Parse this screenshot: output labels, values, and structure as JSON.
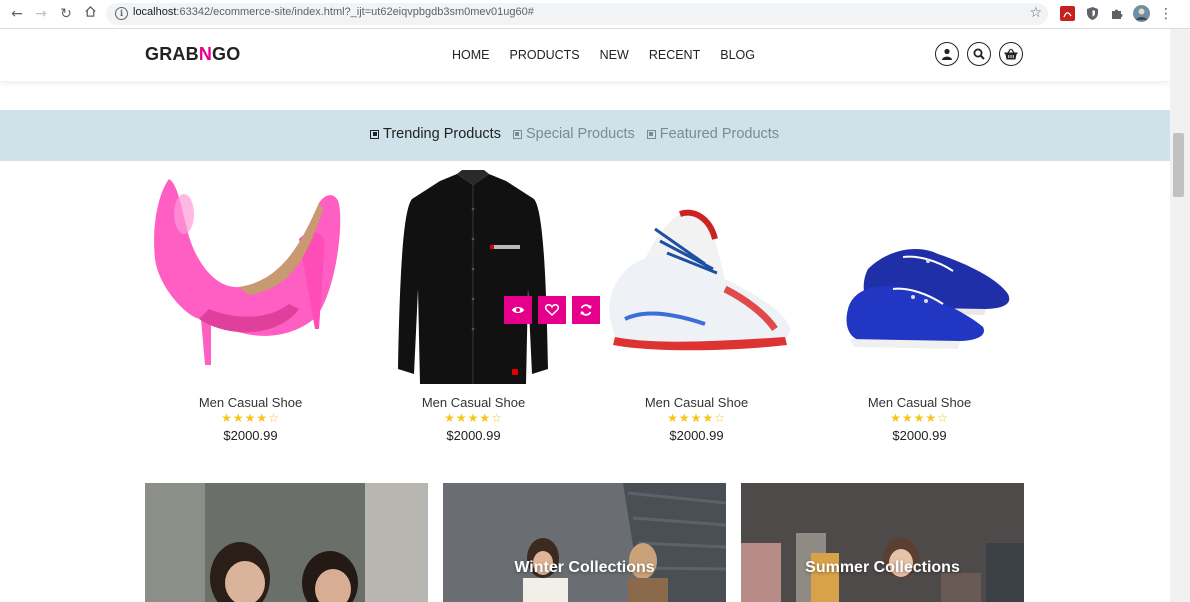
{
  "browser": {
    "url_host": "localhost",
    "url_path": ":63342/ecommerce-site/index.html?_ijt=ut62eiqvpbgdb3sm0mev01ug60#"
  },
  "site": {
    "logo_prefix": "GRAB",
    "logo_accent": "N",
    "logo_suffix": "GO",
    "accent_color": "#e5008b"
  },
  "nav": {
    "items": [
      {
        "label": "HOME"
      },
      {
        "label": "PRODUCTS"
      },
      {
        "label": "NEW"
      },
      {
        "label": "RECENT"
      },
      {
        "label": "BLOG"
      }
    ],
    "icons": [
      "user-icon",
      "search-icon",
      "basket-icon"
    ]
  },
  "tabs": [
    {
      "label": "Trending Products",
      "active": true
    },
    {
      "label": "Special Products",
      "active": false
    },
    {
      "label": "Featured Products",
      "active": false
    }
  ],
  "products": [
    {
      "name": "Men Casual Shoe",
      "stars": "★★★★☆",
      "rating": 4,
      "price": "$2000.99",
      "image": "pink-heel-image"
    },
    {
      "name": "Men Casual Shoe",
      "stars": "★★★★☆",
      "rating": 4,
      "price": "$2000.99",
      "image": "black-shirt-image"
    },
    {
      "name": "Men Casual Shoe",
      "stars": "★★★★☆",
      "rating": 4,
      "price": "$2000.99",
      "image": "sneaker-image"
    },
    {
      "name": "Men Casual Shoe",
      "stars": "★★★★☆",
      "rating": 4,
      "price": "$2000.99",
      "image": "blue-loafer-image"
    }
  ],
  "product_actions": [
    "eye-icon",
    "heart-icon",
    "refresh-icon"
  ],
  "banners": [
    {
      "label": ""
    },
    {
      "label": "Winter Collections"
    },
    {
      "label": "Summer Collections"
    }
  ]
}
